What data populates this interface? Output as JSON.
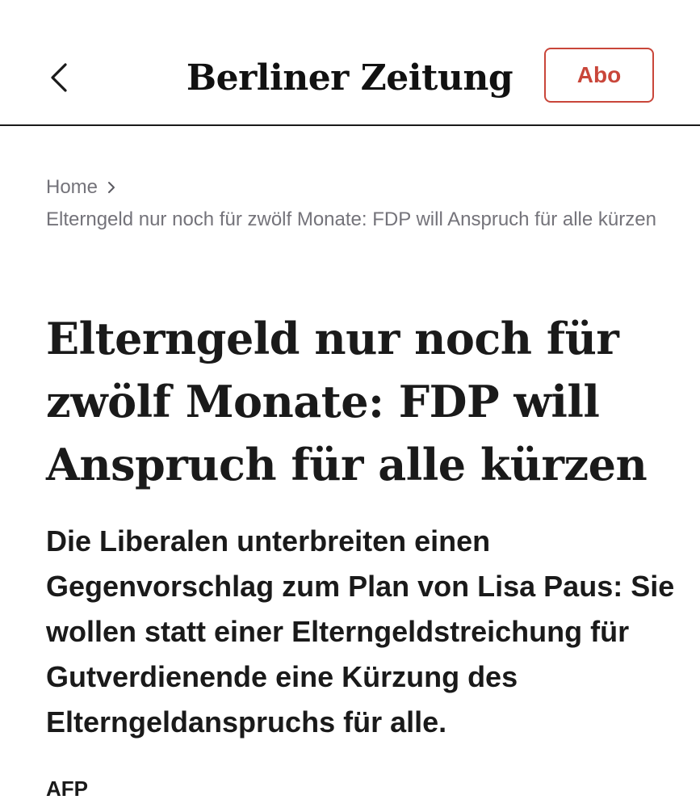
{
  "header": {
    "back_icon": "chevron-left-icon",
    "logo_text": "Berliner Zeitung",
    "abo_label": "Abo",
    "accent_color": "#c9463a"
  },
  "breadcrumb": {
    "home_label": "Home",
    "separator_icon": "chevron-right-icon",
    "current_label": "Elterngeld nur noch für zwölf Monate: FDP will Anspruch für alle kürzen"
  },
  "article": {
    "headline": "Elterngeld nur noch für zwölf Monate: FDP will Anspruch für alle kürzen",
    "lead": "Die Liberalen unterbreiten einen Gegenvorschlag zum Plan von Lisa Paus: Sie wollen statt einer Elterngeldstreichung für Gutverdienende eine Kürzung des Elterngeldanspruchs für alle.",
    "source": "AFP"
  }
}
